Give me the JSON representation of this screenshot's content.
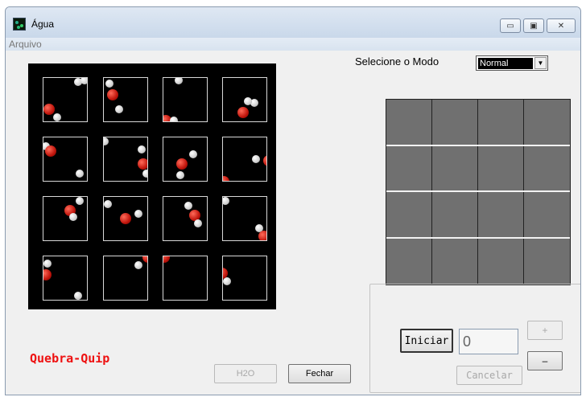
{
  "window": {
    "title": "Água",
    "controls": {
      "minimize": "▭",
      "maximize": "▣",
      "close": "✕"
    }
  },
  "menu": {
    "items": [
      {
        "label": "Arquivo"
      }
    ]
  },
  "mode": {
    "label": "Selecione o Modo",
    "selected": "Normal",
    "arrow": "▼"
  },
  "buttons": {
    "iniciar": "Iniciar",
    "cancelar": "Cancelar",
    "plus": "+",
    "minus": "–",
    "h2o": "H2O",
    "fechar": "Fechar"
  },
  "counter": {
    "value": "0"
  },
  "brand": {
    "text": "Quebra-Quip"
  },
  "puzzle": {
    "rows": 4,
    "cols": 4
  },
  "target_grid": {
    "rows": 4,
    "cols": 4
  },
  "colors": {
    "oxygen": "#d01a10",
    "hydrogen": "#e6e6e6",
    "board_bg": "#000000",
    "target_grid_fill": "#707070",
    "brand": "#ee1111"
  }
}
